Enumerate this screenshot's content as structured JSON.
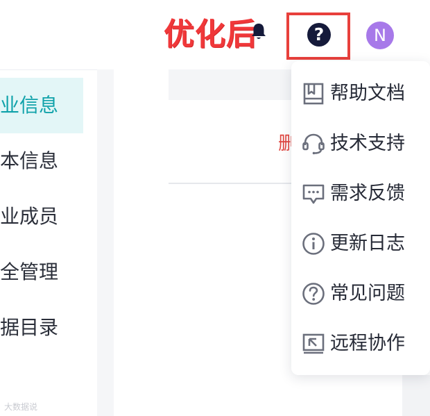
{
  "annotation": {
    "text": "优化后"
  },
  "header": {
    "bell_icon": "bell-icon",
    "help_icon": {
      "name": "help-icon",
      "glyph": "?"
    },
    "avatar": {
      "initial": "N",
      "color": "#a779e9"
    }
  },
  "sidebar": {
    "items": [
      {
        "label": "企业信息",
        "active": true
      },
      {
        "label": "基本信息",
        "active": false
      },
      {
        "label": "企业成员",
        "active": false
      },
      {
        "label": "安全管理",
        "active": false
      },
      {
        "label": "数据目录",
        "active": false
      }
    ]
  },
  "main": {
    "partial_text": "删"
  },
  "dropdown": {
    "items": [
      {
        "label": "帮助文档",
        "icon": "book-icon"
      },
      {
        "label": "技术支持",
        "icon": "headset-icon"
      },
      {
        "label": "需求反馈",
        "icon": "feedback-icon"
      },
      {
        "label": "更新日志",
        "icon": "info-icon"
      },
      {
        "label": "常见问题",
        "icon": "question-icon"
      },
      {
        "label": "远程协作",
        "icon": "remote-screen-icon"
      }
    ]
  },
  "watermark": {
    "text": "大数据说"
  },
  "colors": {
    "accent": "#10a2aa",
    "active_bg": "#e3f6f7",
    "annotation": "#f0383a",
    "highlight_border": "#e8403c"
  }
}
